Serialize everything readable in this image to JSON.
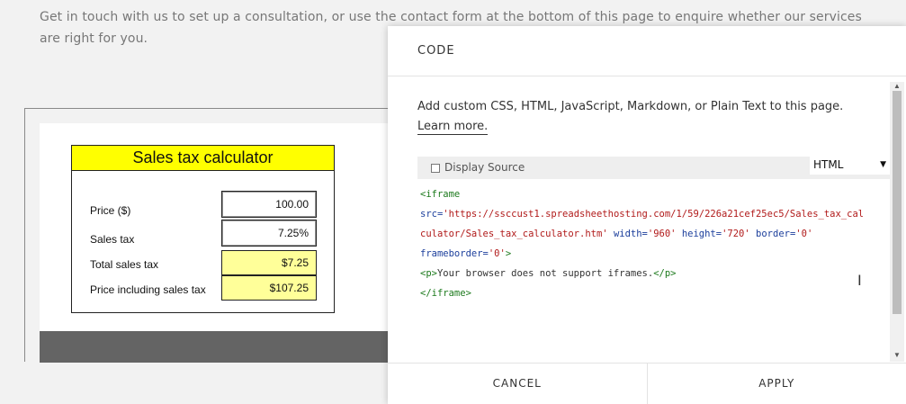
{
  "page": {
    "intro_text": "Get in touch with us to set up a consultation, or use the contact form at the bottom of this page to enquire whether our services are right for you."
  },
  "calculator": {
    "title": "Sales tax calculator",
    "rows": [
      {
        "label": "Price ($)",
        "value": "100.00"
      },
      {
        "label": "Sales tax",
        "value": "7.25%"
      },
      {
        "label": "Total sales tax",
        "value": "$7.25"
      },
      {
        "label": "Price including sales tax",
        "value": "$107.25"
      }
    ]
  },
  "code_panel": {
    "title": "CODE",
    "description": "Add custom CSS, HTML, JavaScript, Markdown, or Plain Text to this page.",
    "learn_more": "Learn more.",
    "display_source": "Display Source",
    "mode": "HTML",
    "code": {
      "open": "<iframe",
      "src_attr": "src=",
      "src_value_1": "'https://ssccust1.spreadsheethosting.com/1/59/226a21cef25ec5/Sales_tax_cal",
      "src_value_2": "culator/Sales_tax_calculator.htm'",
      "width_attr": "width=",
      "width_value": "'960'",
      "height_attr": "height=",
      "height_value": "'720'",
      "border_attr": "border=",
      "border_value": "'0'",
      "frameborder_attr": "frameborder=",
      "frameborder_value": "'0'",
      "tag_close": ">",
      "p_open": "<p>",
      "p_text": "Your browser does not support iframes.",
      "p_close": "</p>",
      "close": "</iframe>"
    },
    "cancel_label": "CANCEL",
    "apply_label": "APPLY"
  },
  "colors": {
    "calc_header": "#ffff00",
    "calc_output": "#ffff99",
    "code_tag": "#1d7a1d",
    "code_value": "#b11a1a",
    "code_attr": "#1c3f9c"
  },
  "icons": [
    "checkbox-icon",
    "dropdown-arrow-icon",
    "scroll-up-icon",
    "scroll-down-icon",
    "text-cursor-icon"
  ]
}
